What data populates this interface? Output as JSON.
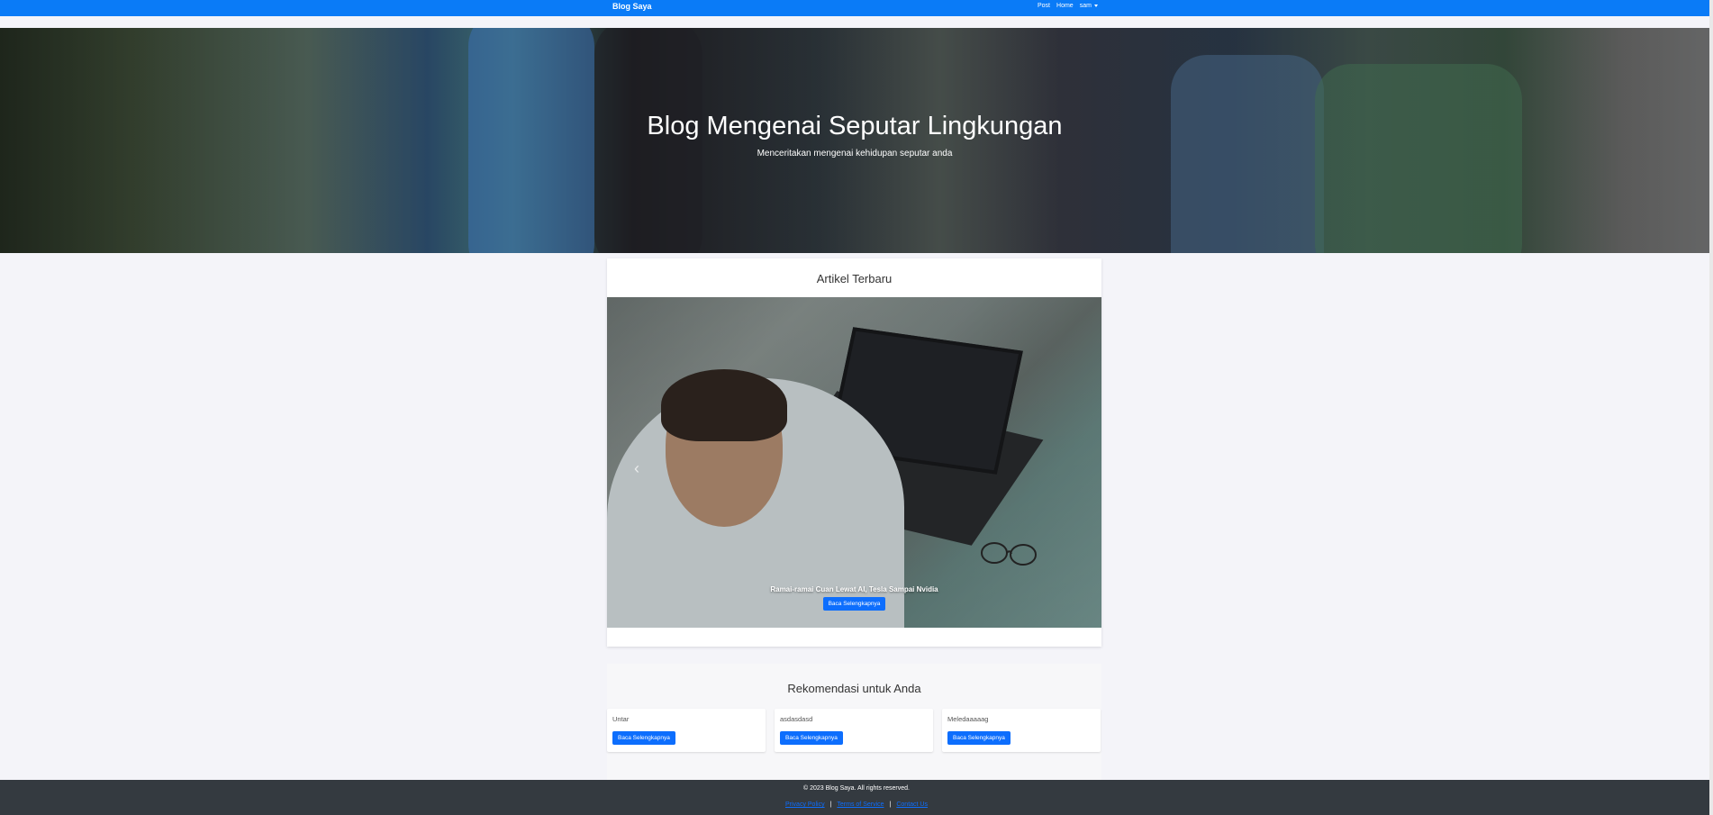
{
  "navbar": {
    "brand": "Blog Saya",
    "links": [
      "Post",
      "Home"
    ],
    "user_menu": "sam"
  },
  "hero": {
    "title": "Blog Mengenai Seputar Lingkungan",
    "subtitle": "Menceritakan mengenai kehidupan seputar anda"
  },
  "latest": {
    "heading": "Artikel Terbaru",
    "slide": {
      "title": "Ramai-ramai Cuan Lewat AI, Tesla Sampai Nvidia",
      "button": "Baca Selengkapnya"
    }
  },
  "recommendations": {
    "heading": "Rekomendasi untuk Anda",
    "cards": [
      {
        "title": "Untar",
        "button": "Baca Selengkapnya"
      },
      {
        "title": "asdasdasd",
        "button": "Baca Selengkapnya"
      },
      {
        "title": "Meledaaaaag",
        "button": "Baca Selengkapnya"
      }
    ]
  },
  "footer": {
    "copyright": "© 2023 Blog Saya. All rights reserved.",
    "links": [
      "Privacy Policy",
      "Terms of Service",
      "Contact Us"
    ]
  },
  "colors": {
    "navbar": "#0a7bf7",
    "button": "#0d6efd",
    "footer": "#343a40",
    "background": "#f4f4f9"
  }
}
